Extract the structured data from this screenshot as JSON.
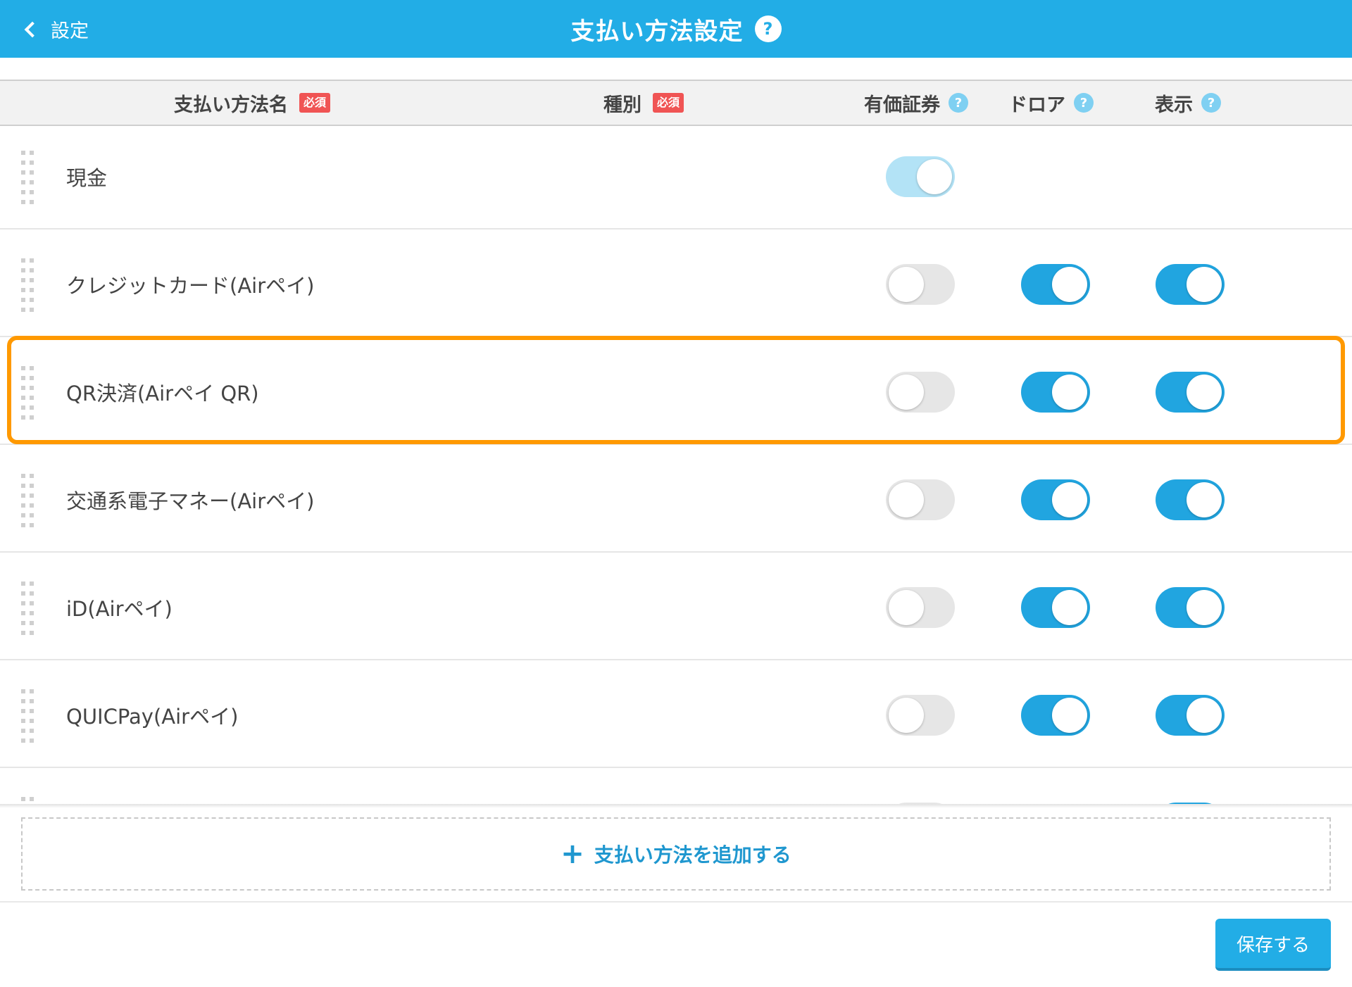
{
  "header": {
    "back_label": "設定",
    "title": "支払い方法設定",
    "help_glyph": "?"
  },
  "columns": {
    "name": "支払い方法名",
    "type": "種別",
    "required_badge": "必須",
    "securities": "有価証券",
    "drawer": "ドロア",
    "display": "表示",
    "help_glyph": "?"
  },
  "rows": [
    {
      "name": "現金",
      "securities": "locked-on",
      "drawer": null,
      "display": null
    },
    {
      "name": "クレジットカード(Airペイ)",
      "securities": "off",
      "drawer": "on",
      "display": "on"
    },
    {
      "name": "QR決済(Airペイ QR)",
      "securities": "off",
      "drawer": "on",
      "display": "on",
      "highlighted": true
    },
    {
      "name": "交通系電子マネー(Airペイ)",
      "securities": "off",
      "drawer": "on",
      "display": "on"
    },
    {
      "name": "iD(Airペイ)",
      "securities": "off",
      "drawer": "on",
      "display": "on"
    },
    {
      "name": "QUICPay(Airペイ)",
      "securities": "off",
      "drawer": "on",
      "display": "on"
    },
    {
      "name": "",
      "securities": "off",
      "drawer": null,
      "display": "on"
    }
  ],
  "footer": {
    "add_label": "支払い方法を追加する",
    "add_icon": "plus-icon",
    "save_label": "保存する"
  },
  "colors": {
    "header": "#22ade6",
    "toggle_on": "#21a5e0",
    "toggle_off": "#e6e6e6",
    "required": "#f05454",
    "highlight": "#ff9900"
  }
}
